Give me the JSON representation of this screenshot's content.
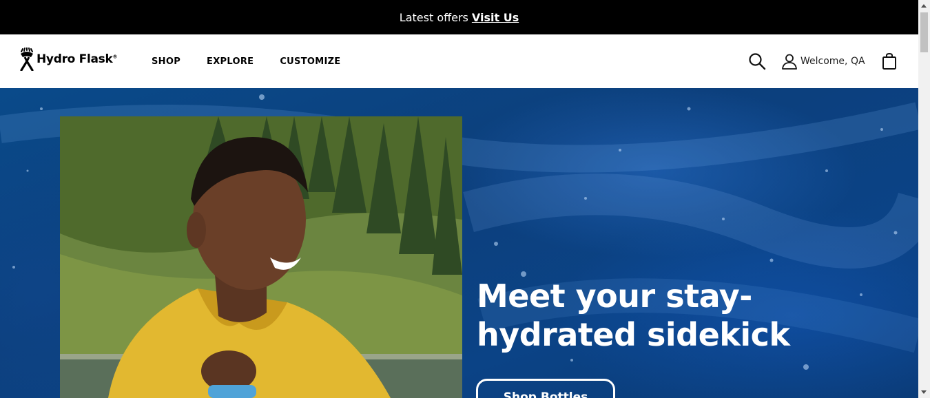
{
  "promo": {
    "text": "Latest offers",
    "link_label": "Visit Us"
  },
  "header": {
    "logo_text": "Hydro Flask",
    "logo_reg": "®",
    "nav": [
      {
        "label": "SHOP"
      },
      {
        "label": "EXPLORE"
      },
      {
        "label": "CUSTOMIZE"
      }
    ],
    "search_icon": "search-icon",
    "account_label": "Welcome, QA",
    "account_icon": "user-icon",
    "cart_icon": "shopping-bag-icon"
  },
  "hero": {
    "heading": "Meet your stay-hydrated sidekick",
    "cta_label": "Shop Bottles",
    "image_alt": "man in yellow jacket holding a bottle by a mountain lake"
  },
  "colors": {
    "promo_bg": "#000000",
    "hero_bg": "#0b4386",
    "text_light": "#ffffff"
  }
}
